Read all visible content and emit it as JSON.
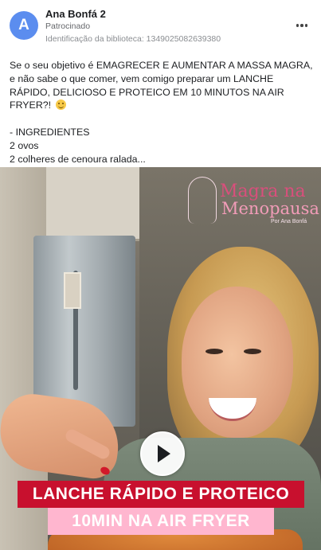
{
  "ad": {
    "page_name": "Ana Bonfá 2",
    "avatar_letter": "A",
    "sponsored_label": "Patrocinado",
    "library_id": "Identificação da biblioteca: 1349025082639380",
    "more_label": "More options"
  },
  "post": {
    "paragraph": "Se o seu objetivo é EMAGRECER E AUMENTAR A MASSA MAGRA, e não sabe o que comer, vem comigo preparar um LANCHE RÁPIDO, DELICIOSO E PROTEICO EM 10 MINUTOS NA AIR FRYER?!",
    "emoji": "smiling-face-savoring-food",
    "ingredients_heading": "- INGREDIENTES",
    "ingredients": [
      "2 ovos",
      "2 colheres de cenoura ralada..."
    ]
  },
  "video": {
    "logo": {
      "line1": "Magra na",
      "line2": "Menopausa",
      "line3": "Por Ana Bonfá"
    },
    "caption_top": "LANCHE RÁPIDO E PROTEICO",
    "caption_bottom": "10MIN NA AIR FRYER",
    "colors": {
      "caption_top_bg": "#c8102e",
      "caption_bottom_bg": "#ffb6cf",
      "logo_pink": "#d94f7c"
    }
  }
}
